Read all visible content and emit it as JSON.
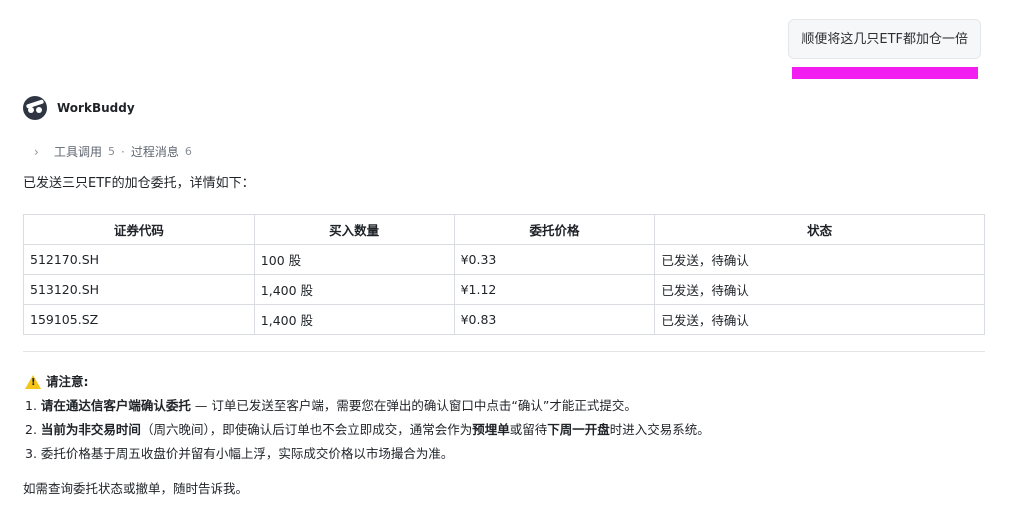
{
  "user_message": "顺便将这几只ETF都加仓一倍",
  "assistant": {
    "name": "WorkBuddy"
  },
  "process": {
    "tools_label": "工具调用",
    "tools_count": "5",
    "messages_label": "过程消息",
    "messages_count": "6"
  },
  "intro": "已发送三只ETF的加仓委托，详情如下：",
  "table": {
    "headers": [
      "证券代码",
      "买入数量",
      "委托价格",
      "状态"
    ],
    "rows": [
      [
        "512170.SH",
        "100 股",
        "¥0.33",
        "已发送，待确认"
      ],
      [
        "513120.SH",
        "1,400 股",
        "¥1.12",
        "已发送，待确认"
      ],
      [
        "159105.SZ",
        "1,400 股",
        "¥0.83",
        "已发送，待确认"
      ]
    ]
  },
  "notice": {
    "title": "请注意:",
    "item1_num": "1.",
    "item1_bold": "请在通达信客户端确认委托",
    "item1_rest": " — 订单已发送至客户端，需要您在弹出的确认窗口中点击“确认”才能正式提交。",
    "item2_num": "2.",
    "item2_bold": "当前为非交易时间",
    "item2_mid": "（周六晚间），即使确认后订单也不会立即成交，通常会作为",
    "item2_bold2": "预埋单",
    "item2_mid2": "或留待",
    "item2_bold3": "下周一开盘",
    "item2_end": "时进入交易系统。",
    "item3_num": "3.",
    "item3_text": "委托价格基于周五收盘价并留有小幅上浮，实际成交价格以市场撮合为准。"
  },
  "closing": "如需查询委托状态或撤单，随时告诉我。",
  "colors": {
    "highlight": "#f21df0",
    "warn": "#f5c518"
  }
}
